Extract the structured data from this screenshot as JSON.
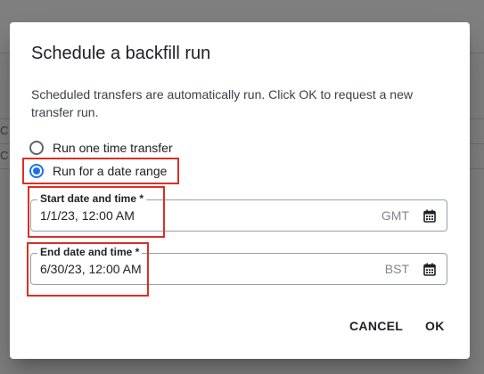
{
  "background": {
    "fragments": [
      "C",
      "C"
    ]
  },
  "dialog": {
    "title": "Schedule a backfill run",
    "description": "Scheduled transfers are automatically run. Click OK to request a new transfer run.",
    "radio_options": [
      {
        "label": "Run one time transfer",
        "checked": false
      },
      {
        "label": "Run for a date range",
        "checked": true
      }
    ],
    "start_field": {
      "label": "Start date and time *",
      "value": "1/1/23, 12:00 AM",
      "timezone": "GMT",
      "icon": "calendar-icon"
    },
    "end_field": {
      "label": "End date and time *",
      "value": "6/30/23, 12:00 AM",
      "timezone": "BST",
      "icon": "calendar-icon"
    },
    "buttons": {
      "cancel": "CANCEL",
      "ok": "OK"
    }
  },
  "colors": {
    "accent": "#1a73e8",
    "highlight": "#d93025",
    "overlay": "#7f7f7f"
  }
}
